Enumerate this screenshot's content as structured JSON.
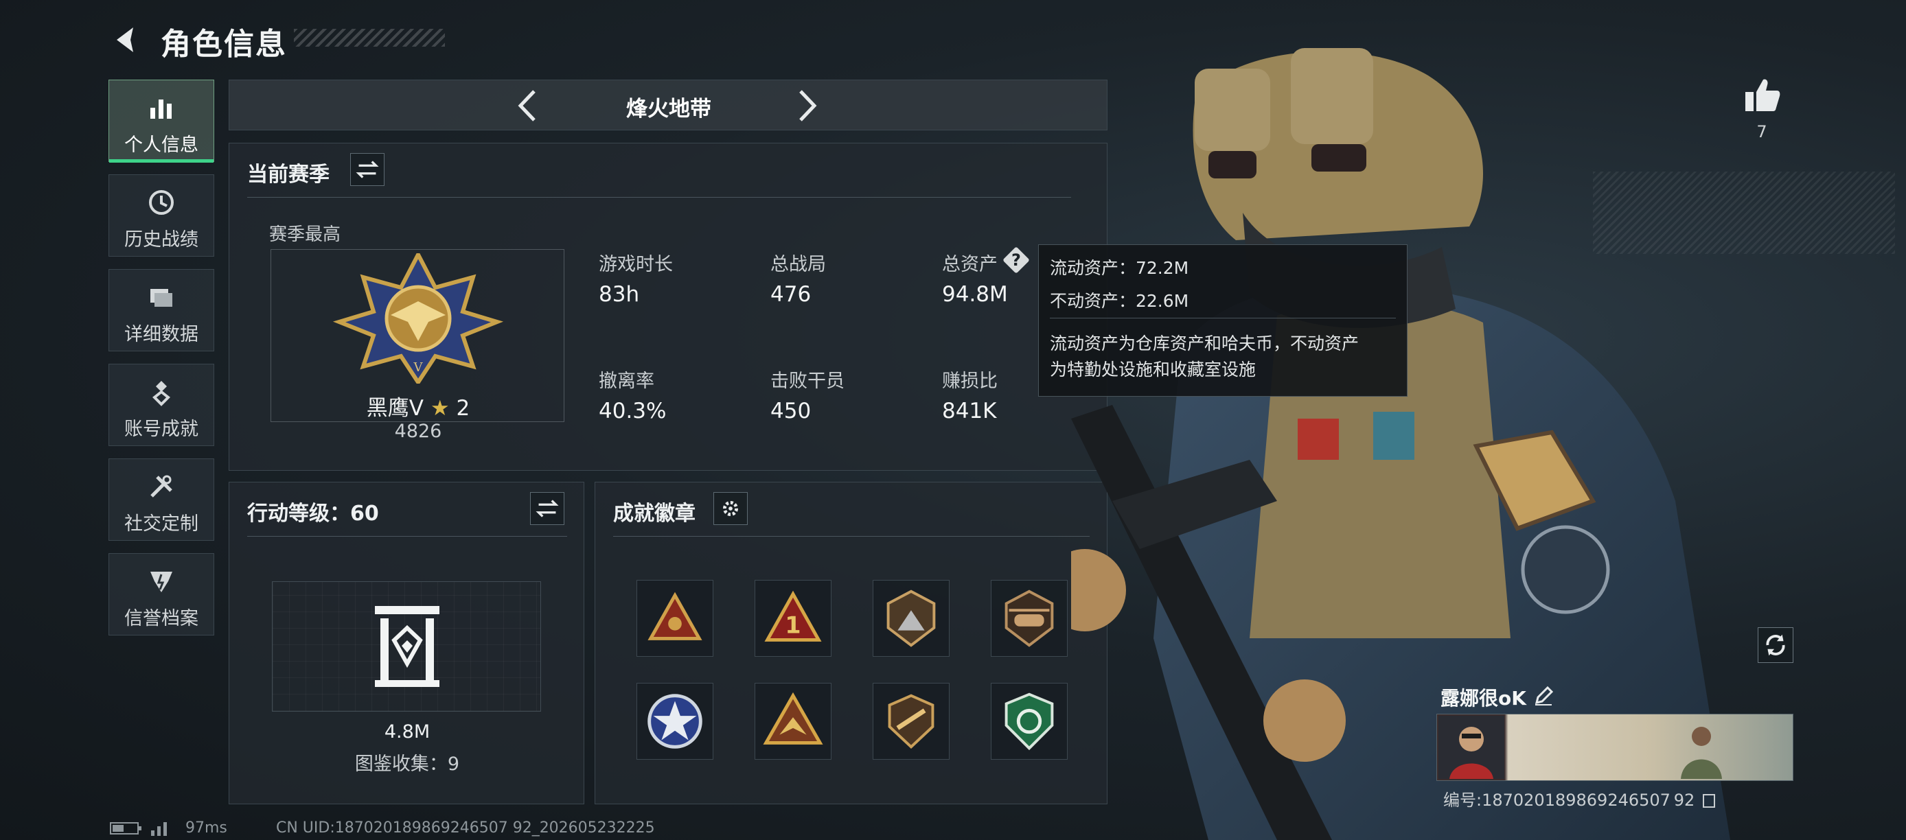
{
  "header": {
    "title": "角色信息"
  },
  "sidebar": {
    "items": [
      {
        "label": "个人信息",
        "icon": "bar-chart-icon",
        "active": true
      },
      {
        "label": "历史战绩",
        "icon": "clock-icon"
      },
      {
        "label": "详细数据",
        "icon": "folder-icon"
      },
      {
        "label": "账号成就",
        "icon": "medal-icon"
      },
      {
        "label": "社交定制",
        "icon": "tools-icon"
      },
      {
        "label": "信誉档案",
        "icon": "shield-icon"
      }
    ]
  },
  "mode": {
    "name": "烽火地带"
  },
  "season": {
    "title": "当前赛季",
    "best_label": "赛季最高",
    "rank_name": "黑鹰V",
    "rank_stars": "2",
    "rank_score": "4826",
    "stats": [
      {
        "label": "游戏时长",
        "value": "83h"
      },
      {
        "label": "总战局",
        "value": "476"
      },
      {
        "label": "总资产",
        "value": "94.8M"
      },
      {
        "label": "撤离率",
        "value": "40.3%"
      },
      {
        "label": "击败干员",
        "value": "450"
      },
      {
        "label": "赚损比",
        "value": "841K"
      }
    ]
  },
  "tooltip": {
    "line1": "流动资产：72.2M",
    "line2": "不动资产：22.6M",
    "line3": "流动资产为仓库资产和哈夫币，不动资产",
    "line4": "为特勤处设施和收藏室设施"
  },
  "action_level": {
    "title": "行动等级：60",
    "value": "4.8M",
    "collection": "图鉴收集：9"
  },
  "achievements": {
    "title": "成就徽章",
    "badges": [
      "triangle-emblem-icon",
      "rank-one-icon",
      "mountain-shield-icon",
      "helicopter-icon",
      "star-medal-icon",
      "eagle-triangle-icon",
      "gun-shield-icon",
      "green-shield-icon"
    ]
  },
  "likes": {
    "count": "7"
  },
  "profile": {
    "name": "露娜很oK",
    "id": "编号:187020189869246507 92"
  },
  "status_bar": {
    "ping": "97ms",
    "uid": "CN UID:187020189869246507 92_202605232225"
  },
  "colors": {
    "accent": "#3ed38a",
    "panel": "#22292f",
    "gold": "#c9a24a"
  }
}
